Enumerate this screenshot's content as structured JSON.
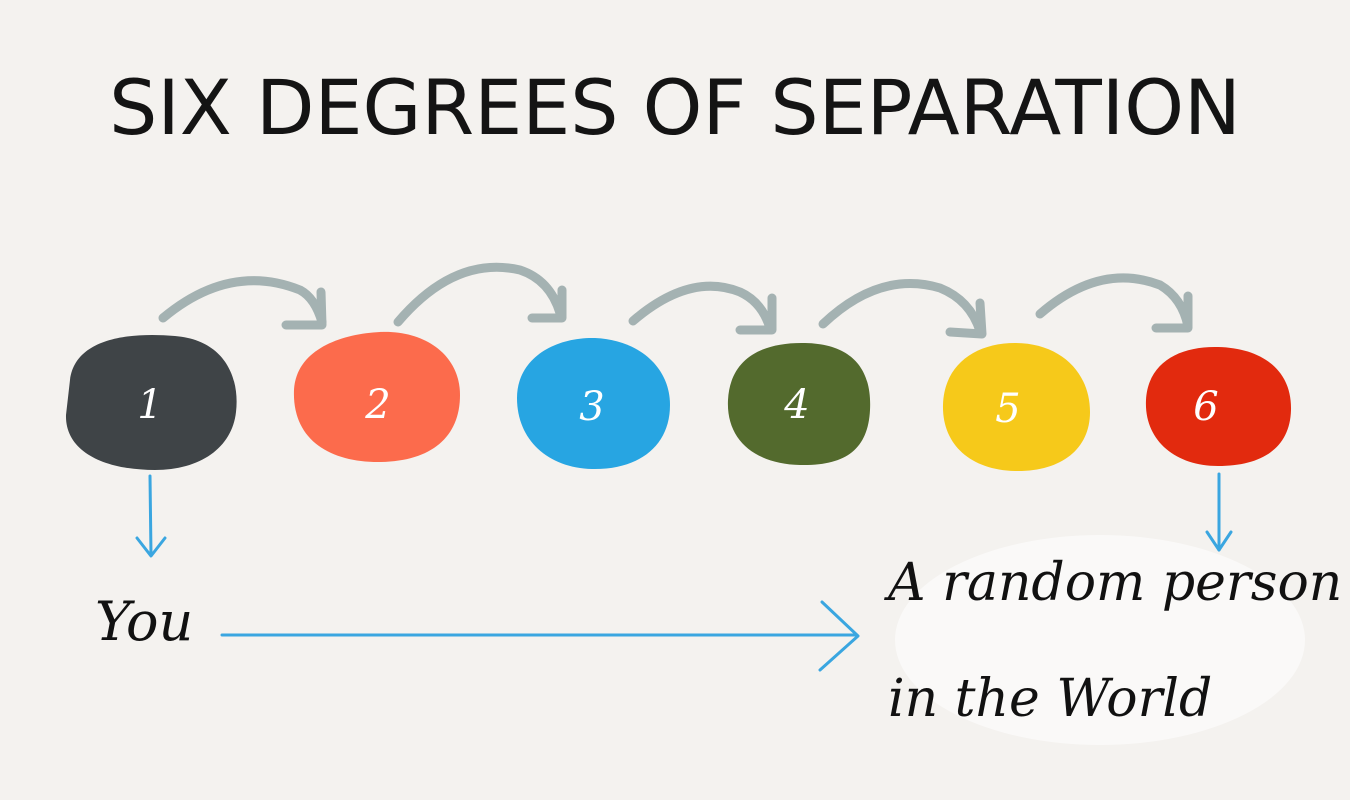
{
  "title": "SIX DEGREES OF SEPARATION",
  "nodes": [
    {
      "label": "1",
      "color": "#3f4447"
    },
    {
      "label": "2",
      "color": "#fc6b4c"
    },
    {
      "label": "3",
      "color": "#27a5e2"
    },
    {
      "label": "4",
      "color": "#536a2d"
    },
    {
      "label": "5",
      "color": "#f6c91a"
    },
    {
      "label": "6",
      "color": "#e22a0e"
    }
  ],
  "start_label": "You",
  "end_label": {
    "line1": "A random person",
    "line2": "in the World"
  },
  "colors": {
    "background": "#f4f2ef",
    "curve_arrow": "#a4b2b2",
    "pointer_arrow": "#3aa6e0",
    "text": "#111111"
  },
  "icons": {
    "curve_arrow": "curved-arrow-icon",
    "pointer_arrow": "down-arrow-icon",
    "long_arrow": "right-arrow-icon"
  }
}
